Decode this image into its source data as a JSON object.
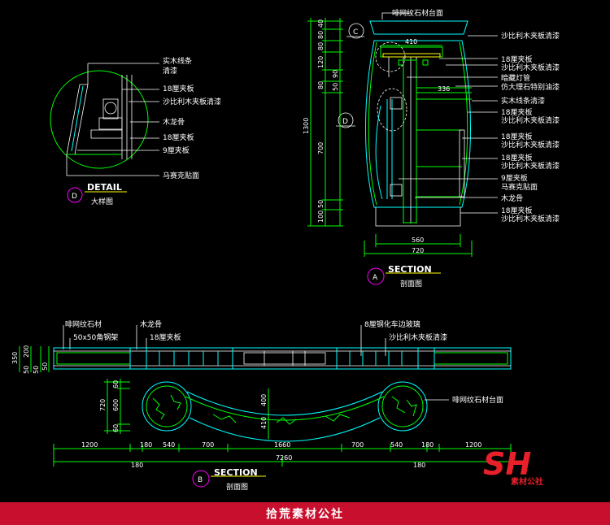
{
  "detail": {
    "title": "DETAIL",
    "subtitle": "大样图",
    "marker": "D",
    "labels": [
      "实木线条",
      "清漆",
      "18厘夹板",
      "沙比利木夹板清漆",
      "木龙骨",
      "18厘夹板",
      "9厘夹板",
      "马赛克贴面"
    ]
  },
  "section_a": {
    "title": "SECTION",
    "subtitle": "剖面图",
    "marker": "A",
    "callouts": [
      "C",
      "D"
    ],
    "top_label": "啡网纹石材台面",
    "labels": [
      "沙比利木夹板清漆",
      "18厘夹板",
      "沙比利木夹板清漆",
      "暗藏灯管",
      "仿大理石特别油漆",
      "实木线条清漆",
      "18厘夹板",
      "沙比利木夹板清漆",
      "18厘夹板",
      "沙比利木夹板清漆",
      "18厘夹板",
      "沙比利木夹板清漆",
      "9厘夹板",
      "马赛克贴面",
      "木龙骨",
      "18厘夹板",
      "沙比利木夹板清漆"
    ],
    "dims_left": [
      "40",
      "80",
      "80",
      "120",
      "90",
      "80",
      "50",
      "1300",
      "700",
      "50",
      "100"
    ],
    "dims_inner": [
      "410",
      "336"
    ],
    "dims_bottom": [
      "560",
      "720"
    ]
  },
  "section_b": {
    "title": "SECTION",
    "subtitle": "剖面图",
    "marker": "B",
    "labels_top": [
      "啡网纹石材",
      "50x50角钢架",
      "木龙骨",
      "18厘夹板",
      "8厘钢化车边玻璃",
      "沙比利木夹板清漆"
    ],
    "label_right": "啡网纹石材台面",
    "dims_left_top": [
      "350",
      "200",
      "50",
      "50",
      "50"
    ],
    "dims_left_plan": [
      "720",
      "60",
      "600",
      "60"
    ],
    "dims_center": [
      "400",
      "410"
    ],
    "dims_bottom_row1": [
      "1200",
      "180",
      "540",
      "700",
      "1660",
      "700",
      "540",
      "180",
      "1200"
    ],
    "dims_bottom_row2": [
      "180",
      "7260",
      "180"
    ]
  },
  "logo": {
    "text": "SH",
    "caption": "素材公社"
  },
  "footer": {
    "text": "拾荒素材公社"
  },
  "colors": {
    "line": "#00ff00",
    "cyan": "#00ffff",
    "magenta": "#ff00ff",
    "yellow": "#ffff00",
    "footer": "#c8102e",
    "logo": "#e8202a"
  }
}
